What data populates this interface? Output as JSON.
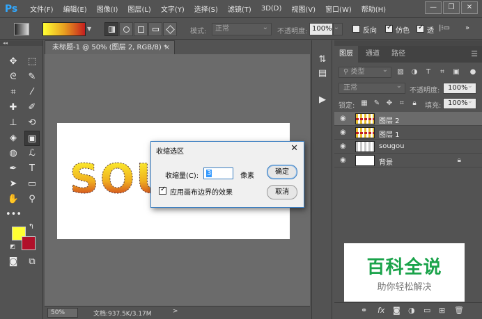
{
  "app": {
    "logo": "Ps"
  },
  "menu": [
    "文件(F)",
    "编辑(E)",
    "图像(I)",
    "图层(L)",
    "文字(Y)",
    "选择(S)",
    "滤镜(T)",
    "3D(D)",
    "视图(V)",
    "窗口(W)",
    "帮助(H)"
  ],
  "window_controls": {
    "minimize": "—",
    "restore": "❐",
    "close": "✕"
  },
  "options": {
    "mode_label": "模式:",
    "mode_value": "正常",
    "opacity_label": "不透明度:",
    "opacity_value": "100%",
    "reverse_label": "反向",
    "reverse_checked": false,
    "dither_label": "仿色",
    "dither_checked": true,
    "transparency_label": "透",
    "transparency_checked": true,
    "gradient_colors": [
      "#ffff33",
      "#e8a020",
      "#c41e1e"
    ]
  },
  "document": {
    "tab_title": "未标题-1 @ 50% (图层 2, RGB/8) *",
    "close_glyph": "×",
    "canvas_text": "SOU",
    "zoom": "50%",
    "doc_size": "文档:937.5K/3.17M",
    "status_arrow": ">"
  },
  "tools": {
    "foreground_color": "#ffff33",
    "background_color": "#b1102a"
  },
  "layers_panel": {
    "tabs": [
      "图层",
      "通道",
      "路径"
    ],
    "active_tab": "图层",
    "filter_kind": "类型",
    "blend_mode": "正常",
    "opacity_label": "不透明度:",
    "opacity_value": "100%",
    "lock_label": "锁定:",
    "fill_label": "填充:",
    "fill_value": "100%",
    "layers": [
      {
        "name": "图层 2",
        "selected": true,
        "visible": true
      },
      {
        "name": "图层 1",
        "selected": false,
        "visible": true
      },
      {
        "name": "sougou",
        "selected": false,
        "visible": true
      },
      {
        "name": "背景",
        "selected": false,
        "visible": true,
        "locked": true
      }
    ]
  },
  "dialog": {
    "title": "收缩选区",
    "amount_label": "收缩量(C):",
    "amount_value": "3",
    "unit": "像素",
    "ok_label": "确定",
    "cancel_label": "取消",
    "apply_canvas_bounds_label": "应用画布边界的效果",
    "apply_canvas_bounds_checked": true
  },
  "watermark": {
    "title": "百科全说",
    "subtitle": "助你轻松解决"
  }
}
